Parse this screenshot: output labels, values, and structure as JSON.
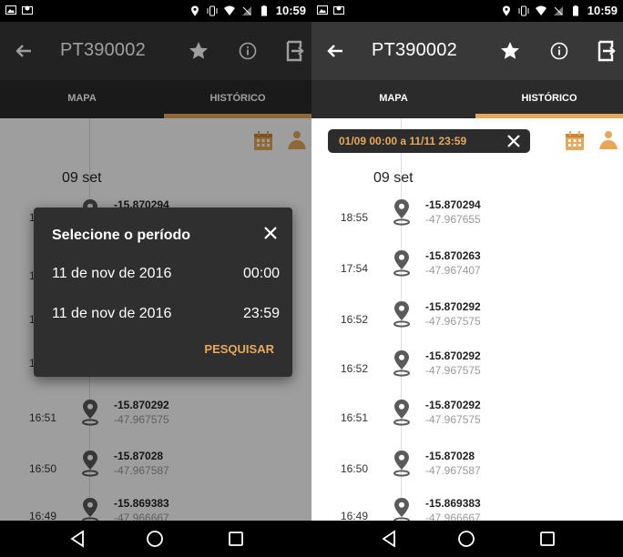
{
  "status_bar": {
    "time": "10:59"
  },
  "app_bar": {
    "title": "PT390002"
  },
  "tabs": {
    "mapa": "MAPA",
    "historico": "HISTÓRICO"
  },
  "filter": {
    "label": "01/09 00:00  a  11/11 23:59"
  },
  "timeline": {
    "day": "09 set",
    "entries": [
      {
        "time": "18:55",
        "lat": "-15.870294",
        "lng": "-47.967655"
      },
      {
        "time": "17:54",
        "lat": "-15.870263",
        "lng": "-47.967407"
      },
      {
        "time": "16:52",
        "lat": "-15.870292",
        "lng": "-47.967575"
      },
      {
        "time": "16:52",
        "lat": "-15.870292",
        "lng": "-47.967575"
      },
      {
        "time": "16:51",
        "lat": "-15.870292",
        "lng": "-47.967575"
      },
      {
        "time": "16:50",
        "lat": "-15.87028",
        "lng": "-47.967587"
      },
      {
        "time": "16:49",
        "lat": "-15.869383",
        "lng": "-47.966667"
      }
    ]
  },
  "dialog": {
    "title": "Selecione o período",
    "start_date": "11 de nov de 2016",
    "start_time": "00:00",
    "end_date": "11 de nov de 2016",
    "end_time": "23:59",
    "search_label": "PESQUISAR"
  },
  "colors": {
    "accent": "#e7a85b",
    "app_bar": "#383838",
    "tab_bar": "#2b2b2b",
    "dialog": "#2f2f2f"
  }
}
